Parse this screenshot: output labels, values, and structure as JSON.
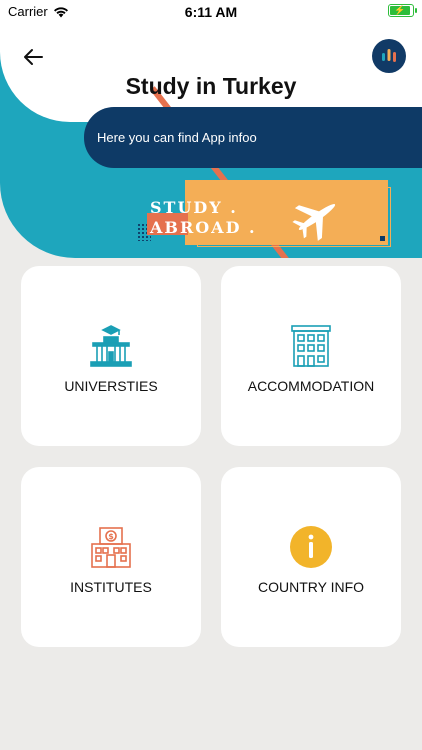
{
  "status_bar": {
    "carrier": "Carrier",
    "time": "6:11 AM"
  },
  "header": {
    "title": "Study in Turkey",
    "info": "Here you can find App infoo"
  },
  "banner": {
    "line1": "STUDY .",
    "line2": "ABROAD ."
  },
  "cards": [
    {
      "label": "UNIVERSTIES",
      "icon": "university-icon",
      "color": "#1a9fb5"
    },
    {
      "label": "ACCOMMODATION",
      "icon": "building-icon",
      "color": "#1a9fb5"
    },
    {
      "label": "INSTITUTES",
      "icon": "bank-icon",
      "color": "#e5714e"
    },
    {
      "label": "COUNTRY INFO",
      "icon": "info-icon",
      "color": "#f2b42a"
    }
  ],
  "colors": {
    "teal": "#1ea6bd",
    "navy": "#0e3a66",
    "orange": "#f4ae56",
    "coral": "#e5714e"
  }
}
